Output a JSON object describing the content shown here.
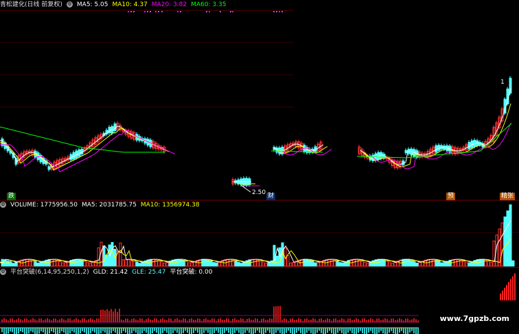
{
  "main_header": {
    "stock": "青松建化(日线 前复权)",
    "ma5": "MA5: 5.05",
    "ma10": "MA10: 4.37",
    "ma20": "MA20: 3.82",
    "ma60": "MA60: 3.35"
  },
  "vol_header": {
    "volume": "VOLUME: 1775956.50",
    "ma5": "MA5: 2031785.75",
    "ma10": "MA10: 1356974.38"
  },
  "ind_header": {
    "name": "平台突破(6,14,95,250,1,2)",
    "gld": "GLD: 21.42",
    "gle": "GLE: 25.47",
    "break": "平台突破: 0.00"
  },
  "price_low_label": "2.50",
  "price_high_label": "1",
  "markers": {
    "left": "跌",
    "cai": "财",
    "mid_right": "预",
    "right": "精张"
  },
  "watermark": "www.7gpzb.com",
  "colors": {
    "ma5": "#ffffff",
    "ma10": "#ffff00",
    "ma20": "#ff00ff",
    "ma60": "#00ff00",
    "up": "#ff3232",
    "down": "#54ffff",
    "grid": "#7a0000"
  },
  "icons": [
    "gear-icon"
  ]
}
